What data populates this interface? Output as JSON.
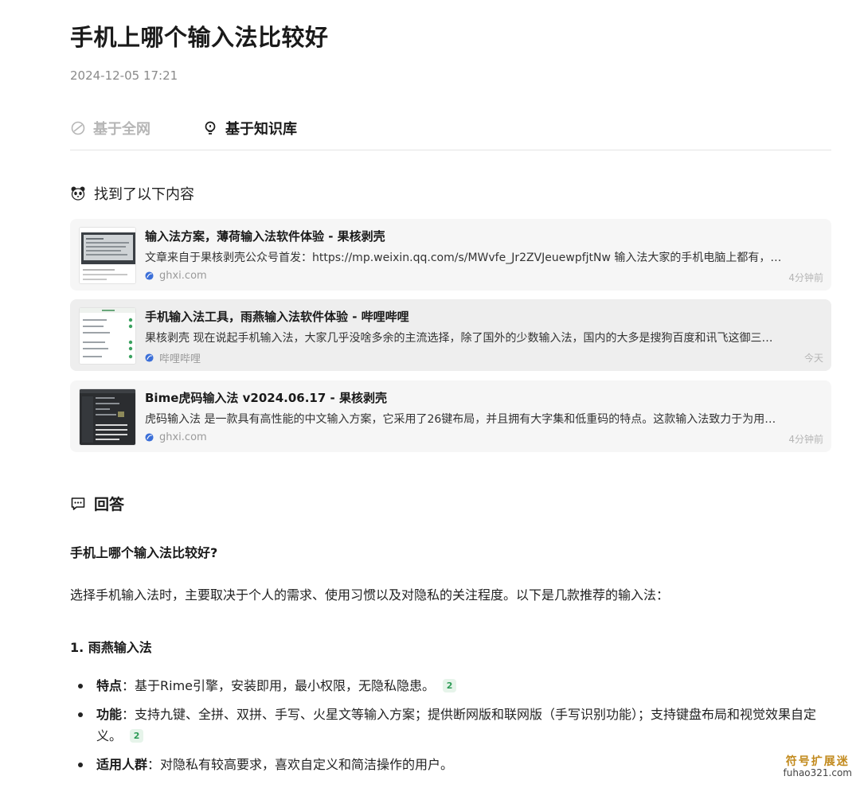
{
  "header": {
    "title": "手机上哪个输入法比较好",
    "date": "2024-12-05 17:21"
  },
  "tabs": [
    {
      "label": "基于全网",
      "icon": "leaf-icon",
      "active": false
    },
    {
      "label": "基于知识库",
      "icon": "lightbulb-icon",
      "active": true
    }
  ],
  "found_label": "找到了以下内容",
  "results": [
    {
      "title": "输入法方案，薄荷输入法软件体验 - 果核剥壳",
      "snippet": "文章来自于果核剥壳公众号首发：https://mp.weixin.qq.com/s/MWvfe_Jr2ZVJeuewpfjtNw 输入法大家的手机电脑上都有，…",
      "source": "ghxi.com",
      "time": "4分钟前"
    },
    {
      "title": "手机输入法工具，雨燕输入法软件体验 - 哔哩哔哩",
      "snippet": "果核剥壳 现在说起手机输入法，大家几乎没啥多余的主流选择，除了国外的少数输入法，国内的大多是搜狗百度和讯飞这御三…",
      "source": "哔哩哔哩",
      "time": "今天"
    },
    {
      "title": "Bime虎码输入法 v2024.06.17 - 果核剥壳",
      "snippet": "虎码输入法 是一款具有高性能的中文输入方案，它采用了26键布局，并且拥有大字集和低重码的特点。这款输入法致力于为用…",
      "source": "ghxi.com",
      "time": "4分钟前"
    }
  ],
  "answer": {
    "heading": "回答",
    "question": "手机上哪个输入法比较好?",
    "intro": "选择手机输入法时，主要取决于个人的需求、使用习惯以及对隐私的关注程度。以下是几款推荐的输入法：",
    "section_title": "1. 雨燕输入法",
    "bullets": [
      {
        "label": "特点",
        "text": "：基于Rime引擎，安装即用，最小权限，无隐私隐患。",
        "cite": "2"
      },
      {
        "label": "功能",
        "text": "：支持九键、全拼、双拼、手写、火星文等输入方案；提供断网版和联网版（手写识别功能）；支持键盘布局和视觉效果自定义。",
        "cite": "2"
      },
      {
        "label": "适用人群",
        "text": "：对隐私有较高要求，喜欢自定义和简洁操作的用户。",
        "cite": ""
      }
    ]
  },
  "watermark": {
    "line1": "符号扩展迷",
    "line2": "fuhao321.com"
  },
  "colors": {
    "card_bg": "#f6f6f6",
    "cite_green": "#2e9b57",
    "inactive_tab": "#b6b6b6"
  }
}
